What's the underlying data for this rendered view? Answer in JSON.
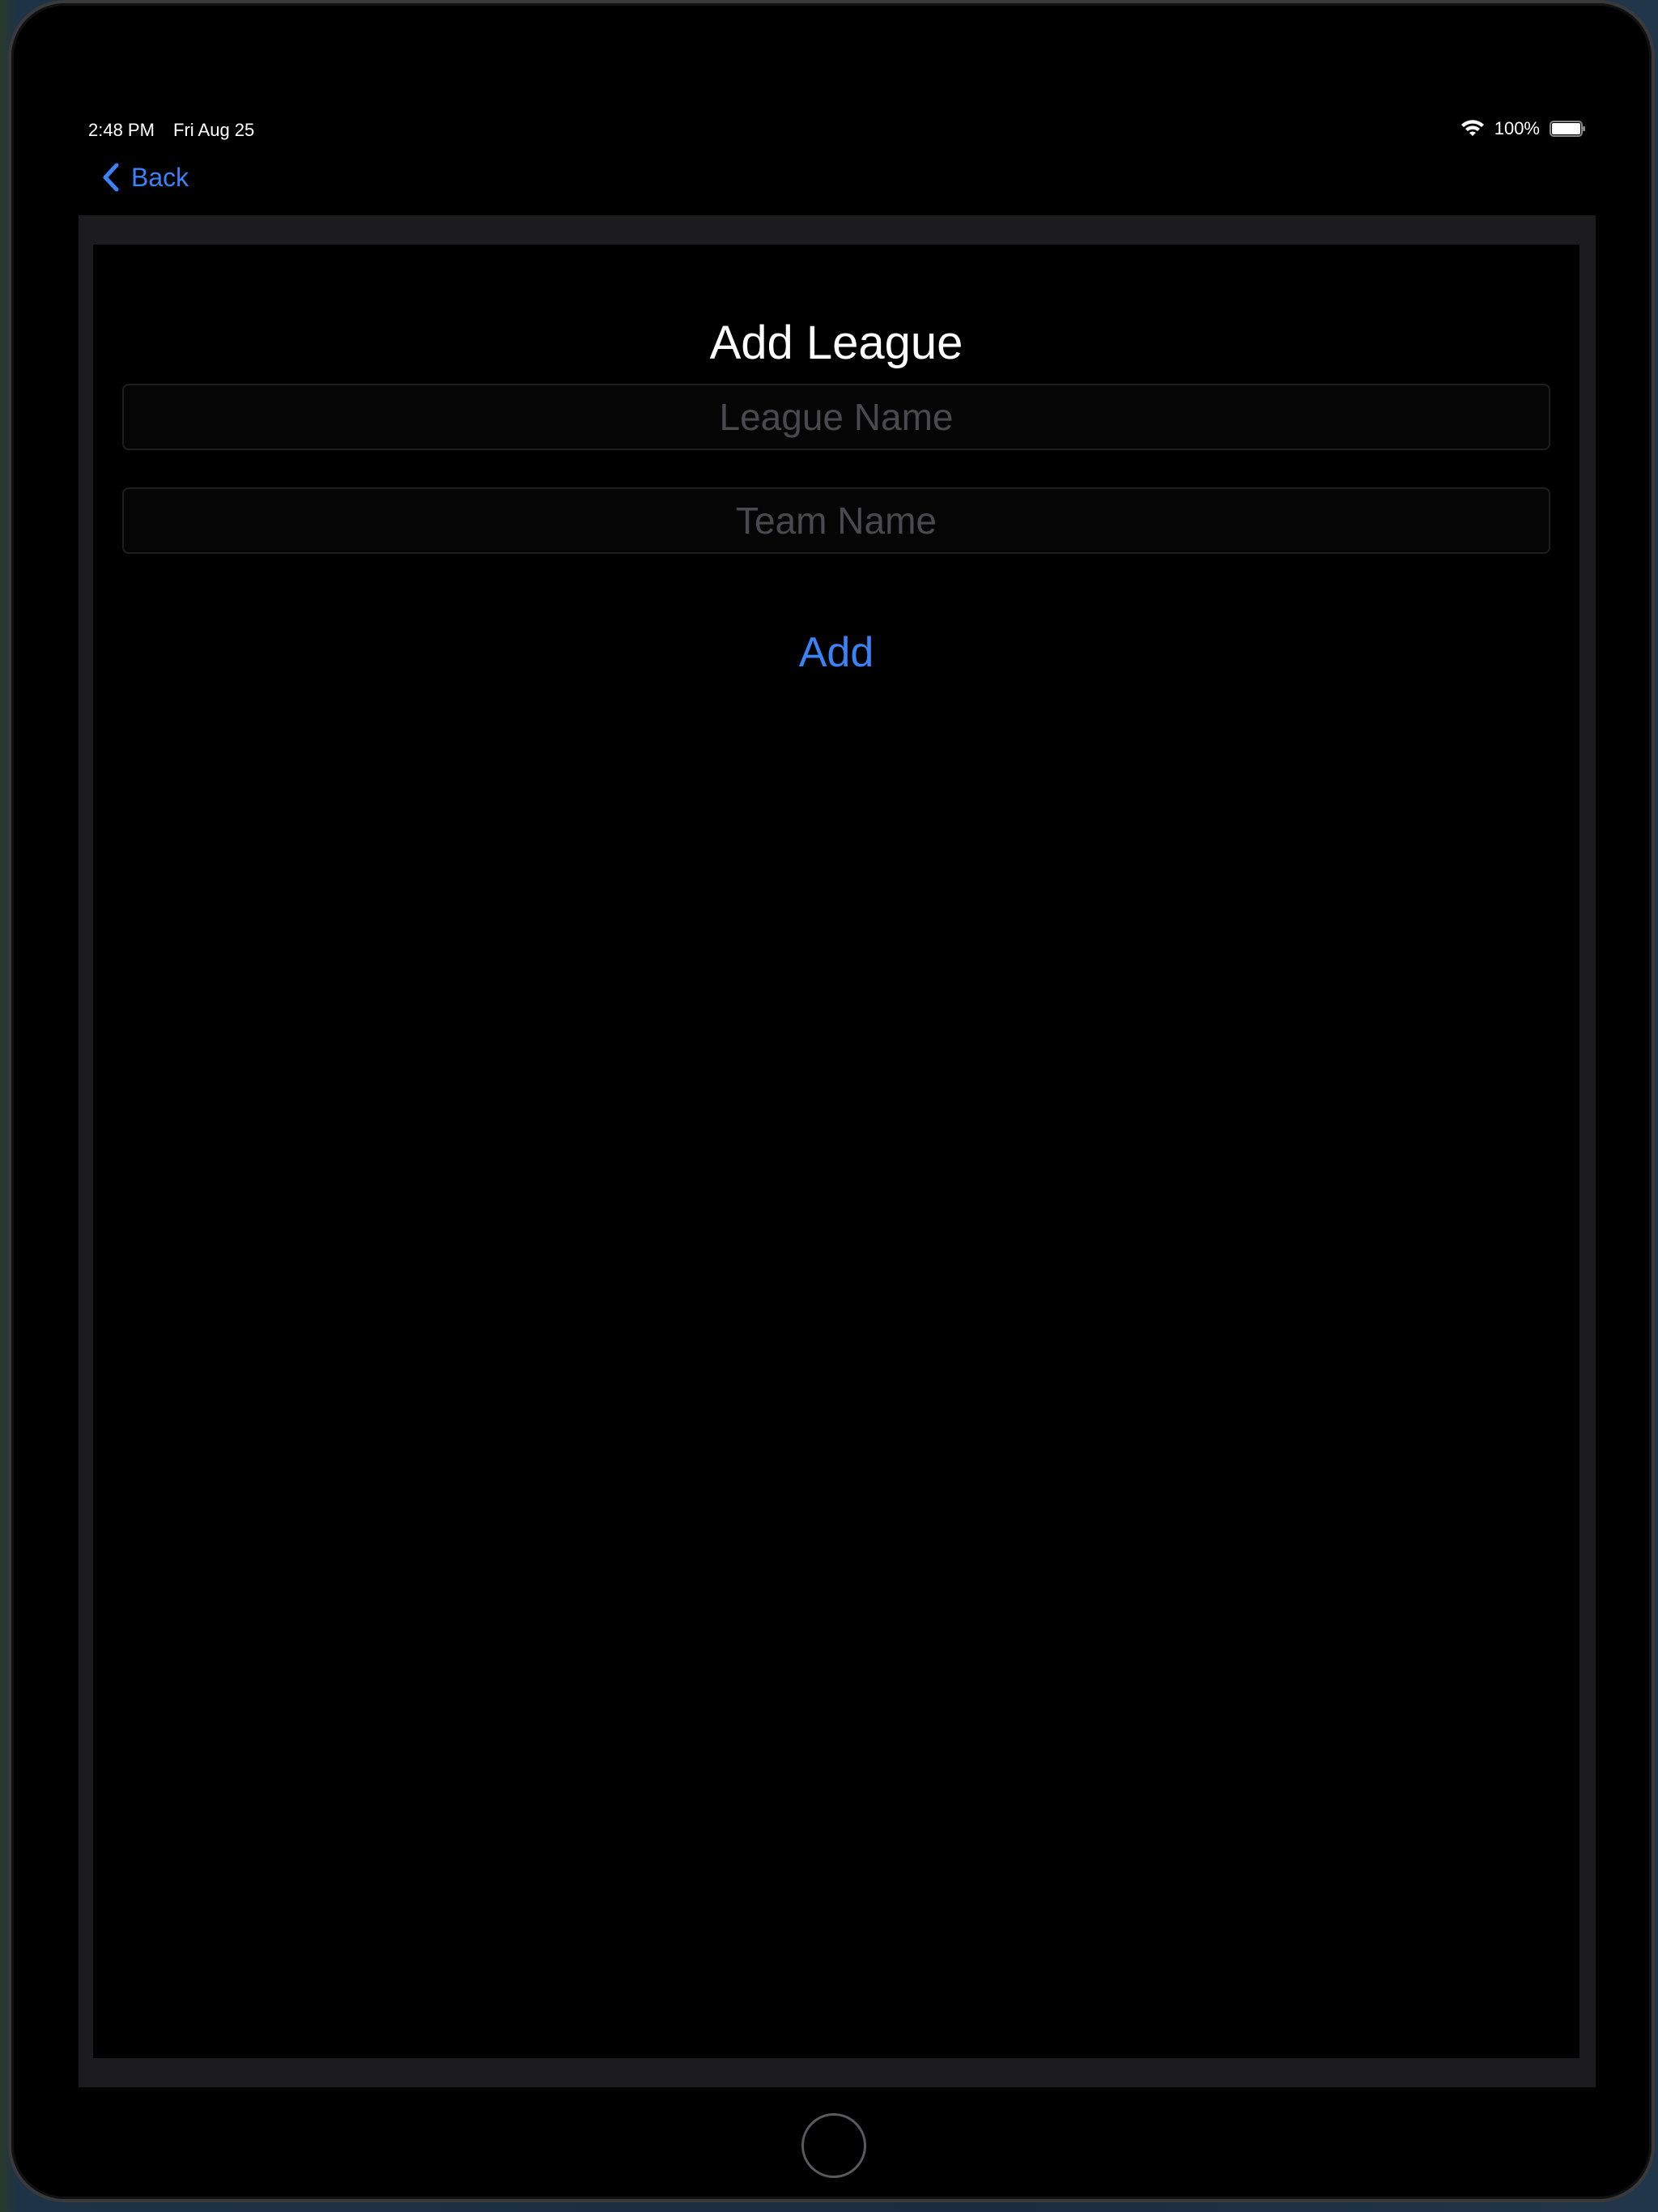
{
  "status_bar": {
    "time": "2:48 PM",
    "date": "Fri Aug 25",
    "battery": "100%"
  },
  "nav": {
    "back_label": "Back"
  },
  "form": {
    "title": "Add League",
    "league_name_placeholder": "League Name",
    "league_name_value": "",
    "team_name_placeholder": "Team Name",
    "team_name_value": "",
    "add_label": "Add"
  },
  "colors": {
    "accent": "#3b82f6",
    "background": "#000000",
    "sheet_border": "#1c1c1e",
    "placeholder": "#4a4a4e"
  },
  "icons": [
    "wifi-icon",
    "battery-icon",
    "chevron-left-icon",
    "home-button"
  ]
}
